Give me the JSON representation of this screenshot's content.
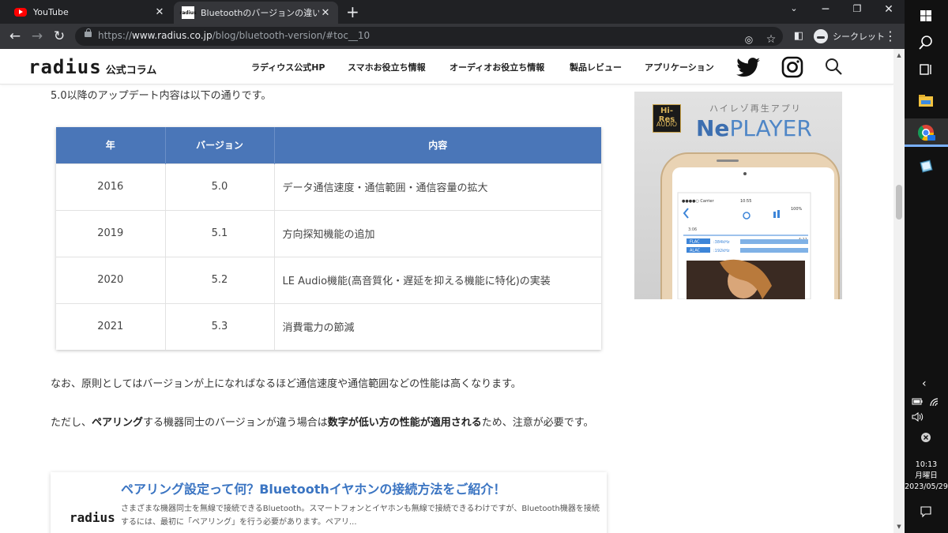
{
  "browser": {
    "tabs": [
      {
        "title": "YouTube",
        "active": false
      },
      {
        "title": "Bluetoothのバージョンの違いについて",
        "active": true
      }
    ],
    "url_prefix": "https://",
    "url_host": "www.radius.co.jp",
    "url_path": "/blog/bluetooth-version/#toc__10",
    "incognito_label": "シークレット"
  },
  "site": {
    "logo_word": "radius",
    "logo_sub": "公式コラム",
    "nav": [
      "ラディウス公式HP",
      "スマホお役立ち情報",
      "オーディオお役立ち情報",
      "製品レビュー",
      "アプリケーション"
    ]
  },
  "article": {
    "intro": "5.0以降のアップデート内容は以下の通りです。",
    "table": {
      "headers": [
        "年",
        "バージョン",
        "内容"
      ],
      "rows": [
        [
          "2016",
          "5.0",
          "データ通信速度・通信範囲・通信容量の拡大"
        ],
        [
          "2019",
          "5.1",
          "方向探知機能の追加"
        ],
        [
          "2020",
          "5.2",
          "LE Audio機能(高音質化・遅延を抑える機能に特化)の実装"
        ],
        [
          "2021",
          "5.3",
          "消費電力の節減"
        ]
      ]
    },
    "para1": "なお、原則としてはバージョンが上になればなるほど通信速度や通信範囲などの性能は高くなります。",
    "para2_a": "ただし、",
    "para2_b": "ペアリング",
    "para2_c": "する機器同士のバージョンが違う場合は",
    "para2_d": "数字が低い方の性能が適用される",
    "para2_e": "ため、注意が必要です。",
    "card": {
      "logo": "radius",
      "title": "ペアリング設定って何？Bluetoothイヤホンの接続方法をご紹介！",
      "desc": "さまざまな機器同士を無線で接続できるBluetooth。スマートフォンとイヤホンも無線で接続できるわけですが、Bluetooth機器を接続するには、最初に「ペアリング」を行う必要があります。ペアリ..."
    }
  },
  "ad": {
    "badge_top": "Hi-Res",
    "badge_bottom": "AUDIO",
    "tagline": "ハイレゾ再生アプリ",
    "brand_ne": "Ne",
    "brand_player": "PLAYER",
    "phone_carrier": "●●●●○ Carrier",
    "phone_time": "10:55",
    "phone_battery": "100%",
    "phone_elapsed": "3:06",
    "phone_remaining": "-4:11",
    "phone_format1": "FLAC",
    "phone_rate1": ":384kHz",
    "phone_format2": "ALAC",
    "phone_rate2": ":192kHz"
  },
  "taskbar": {
    "time": "10:13",
    "weekday": "月曜日",
    "date": "2023/05/29"
  }
}
